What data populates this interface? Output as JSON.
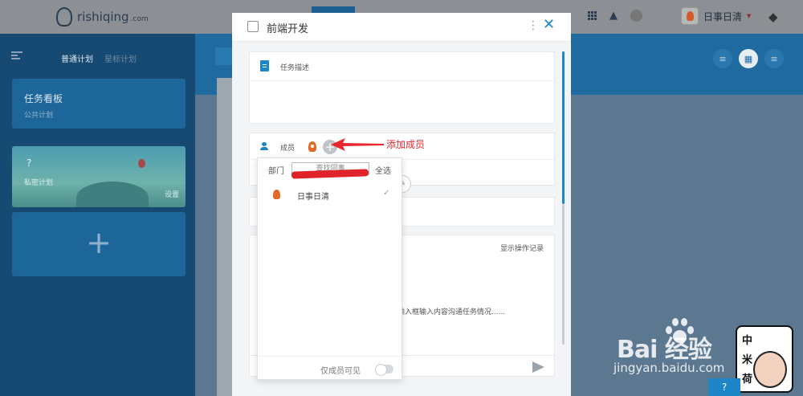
{
  "app": {
    "logo_text": "rishiqing",
    "logo_domain": ".com",
    "user_name": "日事日清"
  },
  "sidebar": {
    "tabs": [
      {
        "label": "普通计划"
      },
      {
        "label": "星标计划"
      }
    ],
    "cards": [
      {
        "title": "任务看板",
        "subtitle": "公共计划"
      },
      {
        "title": "?",
        "subtitle": "私密计划",
        "action": "设置"
      },
      {
        "title": "+"
      }
    ]
  },
  "modal": {
    "title": "前端开发",
    "description_label": "任务描述",
    "members_label": "成员",
    "log_link": "显示操作记录",
    "log_hint": "在输入框输入内容沟通任务情况......"
  },
  "picker": {
    "dept_label": "部门",
    "search_placeholder": "查找同事",
    "select_all": "全选",
    "members": [
      {
        "name": "日事日清",
        "selected": true
      }
    ],
    "visibility_label": "仅成员可见",
    "visibility_on": false
  },
  "annotation": {
    "text": "添加成员",
    "color": "#e8262d"
  },
  "watermark": {
    "brand": "Bai  经验",
    "url": "jingyan.baidu.com",
    "badge_chars": [
      "中",
      "米",
      "荷"
    ]
  },
  "colors": {
    "accent": "#1c86c7",
    "sidebar": "#164a72",
    "band": "#1f6a9f"
  }
}
